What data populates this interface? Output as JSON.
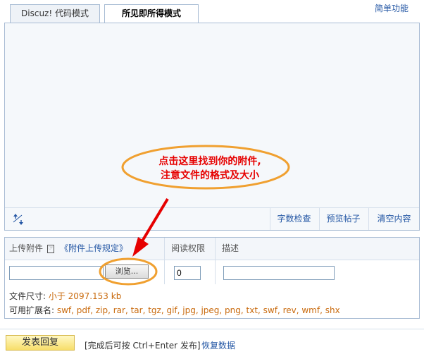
{
  "tabs": [
    {
      "label": "Discuz! 代码模式"
    },
    {
      "label": "所见即所得模式"
    }
  ],
  "simple_mode_label": "简单功能",
  "editor": {
    "resize_icon": "resize-arrows-icon",
    "buttons": {
      "count": "字数检查",
      "preview": "预览帖子",
      "clear": "清空内容"
    }
  },
  "attachments": {
    "upload_label": "上传附件",
    "rules_link": "《附件上传规定》",
    "read_perm_label": "阅读权限",
    "desc_label": "描述",
    "file_path_value": "",
    "browse_label": "浏览...",
    "read_perm_value": "0",
    "desc_value": "",
    "size_label": "文件尺寸: ",
    "size_value": "小于  2097.153 kb",
    "ext_label": "可用扩展名: ",
    "ext_value": "swf, pdf, zip, rar, tar, tgz, gif, jpg, jpeg, png, txt, swf, rev, wmf, shx"
  },
  "annotation": {
    "line1": "点击这里找到你的附件,",
    "line2": "注意文件的格式及大小",
    "color": "#e60000",
    "ellipse_color": "#f0a030"
  },
  "footer": {
    "submit_label": "发表回复",
    "hint": "[完成后可按 Ctrl+Enter 发布]",
    "restore_label": "恢复数据"
  },
  "colors": {
    "link": "#2356a4",
    "border": "#a8bcd4",
    "highlight": "#c96a0d"
  }
}
